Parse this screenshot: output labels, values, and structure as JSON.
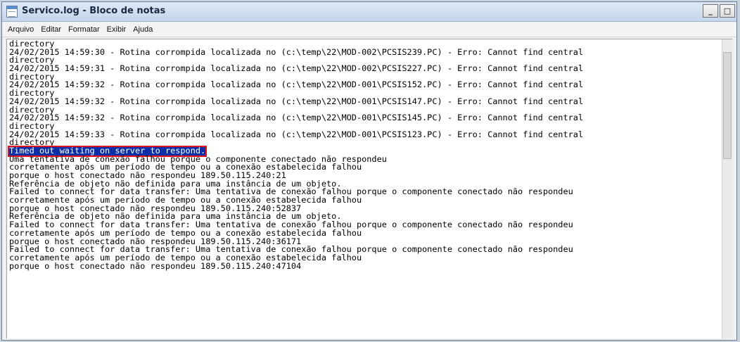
{
  "window": {
    "title": "Servico.log - Bloco de notas",
    "buttons": {
      "minimize": "_",
      "maximize": "□"
    }
  },
  "menu": [
    "Arquivo",
    "Editar",
    "Formatar",
    "Exibir",
    "Ajuda"
  ],
  "editor": {
    "lines": [
      "directory",
      "24/02/2015 14:59:30 - Rotina corrompida localizada no (c:\\temp\\22\\MOD-002\\PCSIS239.PC) - Erro: Cannot find central",
      "directory",
      "24/02/2015 14:59:31 - Rotina corrompida localizada no (c:\\temp\\22\\MOD-002\\PCSIS227.PC) - Erro: Cannot find central",
      "directory",
      "24/02/2015 14:59:32 - Rotina corrompida localizada no (c:\\temp\\22\\MOD-001\\PCSIS152.PC) - Erro: Cannot find central",
      "directory",
      "24/02/2015 14:59:32 - Rotina corrompida localizada no (c:\\temp\\22\\MOD-001\\PCSIS147.PC) - Erro: Cannot find central",
      "directory",
      "24/02/2015 14:59:32 - Rotina corrompida localizada no (c:\\temp\\22\\MOD-001\\PCSIS145.PC) - Erro: Cannot find central",
      "directory",
      "24/02/2015 14:59:33 - Rotina corrompida localizada no (c:\\temp\\22\\MOD-001\\PCSIS123.PC) - Erro: Cannot find central",
      "directory"
    ],
    "selected_line": "Timed out waiting on server to respond.",
    "lines_after": [
      "Uma tentativa de conexão falhou porque o componente conectado não respondeu",
      "corretamente após um período de tempo ou a conexão estabelecida falhou",
      "porque o host conectado não respondeu 189.50.115.240:21",
      "Referência de objeto não definida para uma instância de um objeto.",
      "Failed to connect for data transfer: Uma tentativa de conexão falhou porque o componente conectado não respondeu",
      "corretamente após um período de tempo ou a conexão estabelecida falhou",
      "porque o host conectado não respondeu 189.50.115.240:52837",
      "Referência de objeto não definida para uma instância de um objeto.",
      "Failed to connect for data transfer: Uma tentativa de conexão falhou porque o componente conectado não respondeu",
      "corretamente após um período de tempo ou a conexão estabelecida falhou",
      "porque o host conectado não respondeu 189.50.115.240:36171",
      "Failed to connect for data transfer: Uma tentativa de conexão falhou porque o componente conectado não respondeu",
      "corretamente após um período de tempo ou a conexão estabelecida falhou",
      "porque o host conectado não respondeu 189.50.115.240:47104"
    ]
  },
  "colors": {
    "selection": "#0a2fa6",
    "highlight_border": "#e0141c"
  }
}
